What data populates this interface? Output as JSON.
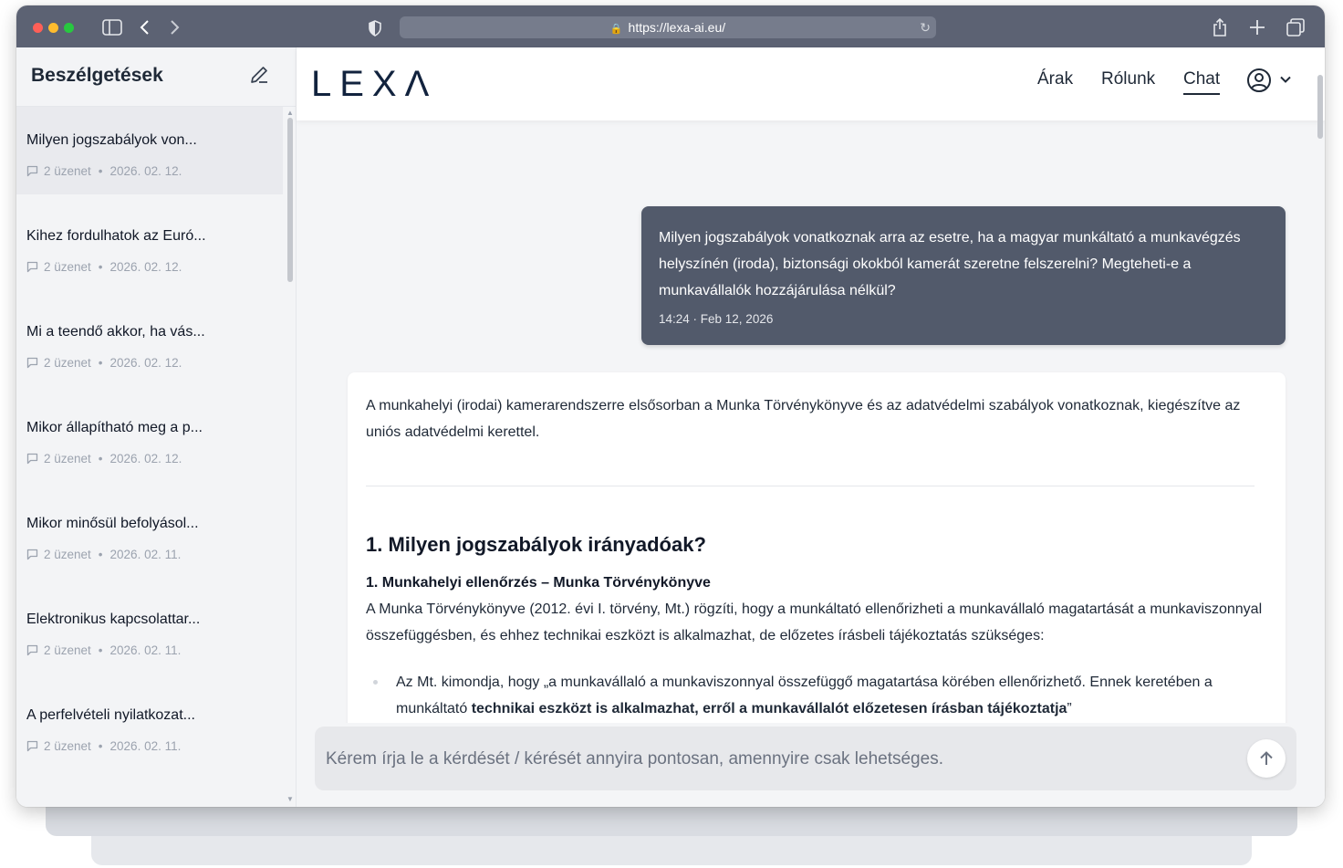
{
  "browser": {
    "url": "https://lexa-ai.eu/",
    "colors": {
      "close": "#ff5f57",
      "minimize": "#febc2e",
      "maximize": "#28c840"
    }
  },
  "sidebar": {
    "title": "Beszélgetések",
    "edit_icon": "pencil-icon",
    "conversations": [
      {
        "title": "Milyen jogszabályok von...",
        "count": "2 üzenet",
        "date": "2026. 02. 12."
      },
      {
        "title": "Kihez fordulhatok az Euró...",
        "count": "2 üzenet",
        "date": "2026. 02. 12."
      },
      {
        "title": "Mi a teendő akkor, ha vás...",
        "count": "2 üzenet",
        "date": "2026. 02. 12."
      },
      {
        "title": "Mikor állapítható meg a p...",
        "count": "2 üzenet",
        "date": "2026. 02. 12."
      },
      {
        "title": "Mikor minősül befolyásol...",
        "count": "2 üzenet",
        "date": "2026. 02. 11."
      },
      {
        "title": "Elektronikus kapcsolattar...",
        "count": "2 üzenet",
        "date": "2026. 02. 11."
      },
      {
        "title": "A perfelvételi nyilatkozat...",
        "count": "2 üzenet",
        "date": "2026. 02. 11."
      }
    ]
  },
  "nav": {
    "logo": "LEXΛ",
    "links": [
      "Árak",
      "Rólunk",
      "Chat"
    ],
    "active": "Chat",
    "accent": "#12233e"
  },
  "chat": {
    "user_message": "Milyen jogszabályok vonatkoznak arra az esetre, ha a magyar munkáltató a munkavégzés helyszínén (iroda), biztonsági okokból kamerát szeretne felszerelni? Megteheti-e a munkavállalók hozzájárulása nélkül?",
    "user_time": "14:24 · Feb 12, 2026",
    "answer": {
      "intro": "A munkahelyi (irodai) kamerarendszerre elsősorban a Munka Törvénykönyve és az adatvédelmi szabályok vonatkoznak, kiegészítve az uniós adatvédelmi kerettel.",
      "h1": "1. Milyen jogszabályok irányadóak?",
      "h2": "1. Munkahelyi ellenőrzés – Munka Törvénykönyve",
      "p": "A Munka Törvénykönyve (2012. évi I. törvény, Mt.) rögzíti, hogy a munkáltató ellenőrizheti a munkavállaló magatartását a munkaviszonnyal összefüggésben, és ehhez technikai eszközt is alkalmazhat, de előzetes írásbeli tájékoztatás szükséges:",
      "li_start": "Az Mt. kimondja, hogy „a munkavállaló a munkaviszonnyal összefüggő magatartása körében ellenőrizhető. Ennek keretében a munkáltató ",
      "li_bold": "technikai eszközt is alkalmazhat, erről a munkavállalót előzetesen írásban tájékoztatja",
      "li_end": "”"
    },
    "input_placeholder": "Kérem írja le a kérdését / kérését annyira pontosan, amennyire csak lehetséges."
  }
}
